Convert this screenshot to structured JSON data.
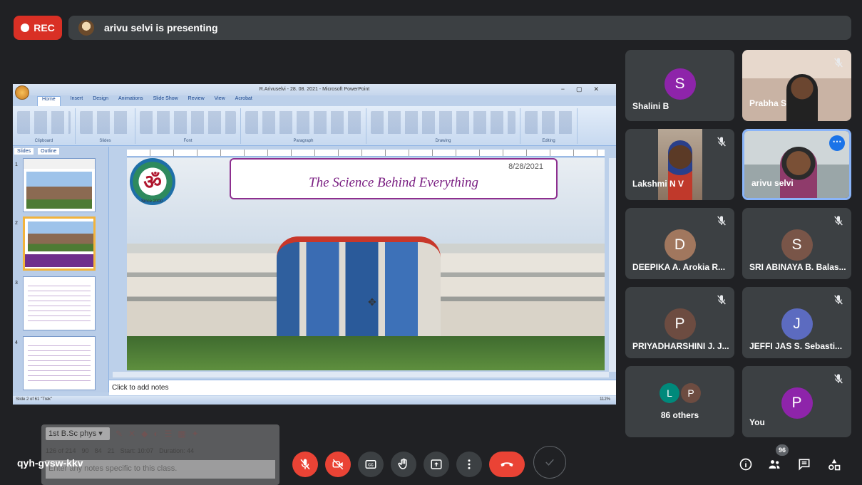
{
  "top": {
    "rec_label": "REC",
    "presenting_text": "arivu selvi is presenting"
  },
  "powerpoint": {
    "window_title": "R.Arivuselvi - 28. 08. 2021 - Microsoft PowerPoint",
    "tabs": [
      "Home",
      "Insert",
      "Design",
      "Animations",
      "Slide Show",
      "Review",
      "View",
      "Acrobat"
    ],
    "ribbon_groups": [
      "Clipboard",
      "Slides",
      "Font",
      "Paragraph",
      "Drawing",
      "Editing"
    ],
    "left_tabs": [
      "Slides",
      "Outline"
    ],
    "slide_numbers": [
      "1",
      "2",
      "3",
      "4"
    ],
    "slide_date": "8/28/2021",
    "slide_title": "The Science Behind Everything",
    "logo_symbol": "ॐ",
    "logo_caption": "Since 2000",
    "notes_placeholder": "Click to add notes",
    "status_left": "Slide 2 of 61   \"Trek\"",
    "status_zoom": "112%"
  },
  "overlay": {
    "class_select": "1st B.Sc phys ▾",
    "stats": [
      "126 of 214",
      "90",
      "84",
      "21",
      "Start: 10:07",
      "Duration: 44"
    ],
    "notes_text": "Enter any notes specific to this class."
  },
  "participants": [
    {
      "name": "Shalini B",
      "initial": "S",
      "color": "#8e24aa",
      "type": "avatar",
      "muted": false
    },
    {
      "name": "Prabha S",
      "type": "photo",
      "muted": true
    },
    {
      "name": "Lakshmi N V",
      "type": "photo",
      "muted": true
    },
    {
      "name": "arivu selvi",
      "type": "photo",
      "muted": false,
      "speaking": true
    },
    {
      "name": "DEEPIKA A. Arokia R...",
      "initial": "D",
      "color": "#a1775e",
      "type": "avatar",
      "muted": true
    },
    {
      "name": "SRI ABINAYA B. Balas...",
      "initial": "S",
      "color": "#795548",
      "type": "avatar",
      "muted": true
    },
    {
      "name": "PRIYADHARSHINI J. J...",
      "initial": "P",
      "color": "#6d4c41",
      "type": "avatar",
      "muted": true
    },
    {
      "name": "JEFFI JAS S. Sebasti...",
      "initial": "J",
      "color": "#5c6bc0",
      "type": "avatar",
      "muted": true
    },
    {
      "name": "86 others",
      "type": "others",
      "initials": [
        "L",
        "P"
      ],
      "colors": [
        "#00897b",
        "#6d4c41"
      ]
    },
    {
      "name": "You",
      "initial": "P",
      "color": "#8e24aa",
      "type": "avatar",
      "muted": true
    }
  ],
  "bottom": {
    "meeting_code": "qyh-gvsw-kkv",
    "participant_count": "96"
  }
}
